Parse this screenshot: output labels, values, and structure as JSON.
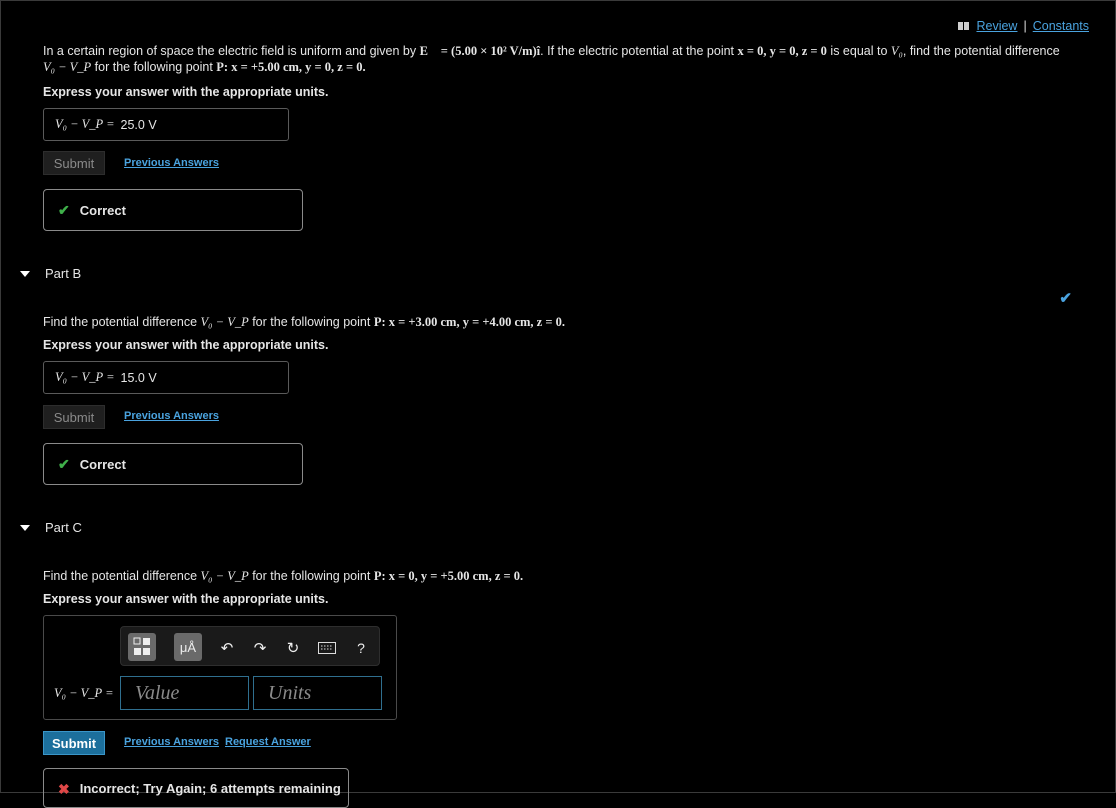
{
  "header": {
    "review_label": "Review",
    "constants_label": "Constants"
  },
  "partA": {
    "question_1": "In a certain region of space the electric field is uniform and given by",
    "field_expr": "E⃗ = (5.00 × 10² V/m)î",
    "question_2": ". If the electric potential at the point",
    "origin_expr": "x = 0, y = 0, z = 0",
    "question_3": "is equal to",
    "v0": "V₀",
    "question_4": ", find the potential difference",
    "diff_expr": "V₀ − V_P",
    "question_5": "for the following point",
    "point_expr": "P: x = +5.00 cm, y = 0, z = 0.",
    "instruction": "Express your answer with the appropriate units.",
    "answer_lhs": "V₀ − V_P =",
    "answer_value": "25.0 V",
    "submit_label": "Submit",
    "previous_answers_label": "Previous Answers",
    "feedback": "Correct"
  },
  "partB": {
    "title": "Part B",
    "question_1": "Find the potential difference",
    "diff_expr": "V₀ − V_P",
    "question_2": "for the following point",
    "point_expr": "P: x = +3.00 cm, y = +4.00 cm, z = 0.",
    "instruction": "Express your answer with the appropriate units.",
    "answer_lhs": "V₀ − V_P =",
    "answer_value": "15.0 V",
    "submit_label": "Submit",
    "previous_answers_label": "Previous Answers",
    "feedback": "Correct"
  },
  "partC": {
    "title": "Part C",
    "question_1": "Find the potential difference",
    "diff_expr": "V₀ − V_P",
    "question_2": "for the following point",
    "point_expr": "P: x = 0, y = +5.00 cm, z = 0.",
    "instruction": "Express your answer with the appropriate units.",
    "answer_lhs": "V₀ − V_P =",
    "value_placeholder": "Value",
    "units_placeholder": "Units",
    "units_button_label": "μÅ",
    "help_label": "?",
    "submit_label": "Submit",
    "previous_answers_label": "Previous Answers",
    "request_answer_label": "Request Answer",
    "feedback": "Incorrect; Try Again; 6 attempts remaining"
  },
  "colors": {
    "link": "#4aa3df",
    "check": "#3fb04a",
    "submit": "#1c6f9c",
    "error": "#e04848"
  }
}
